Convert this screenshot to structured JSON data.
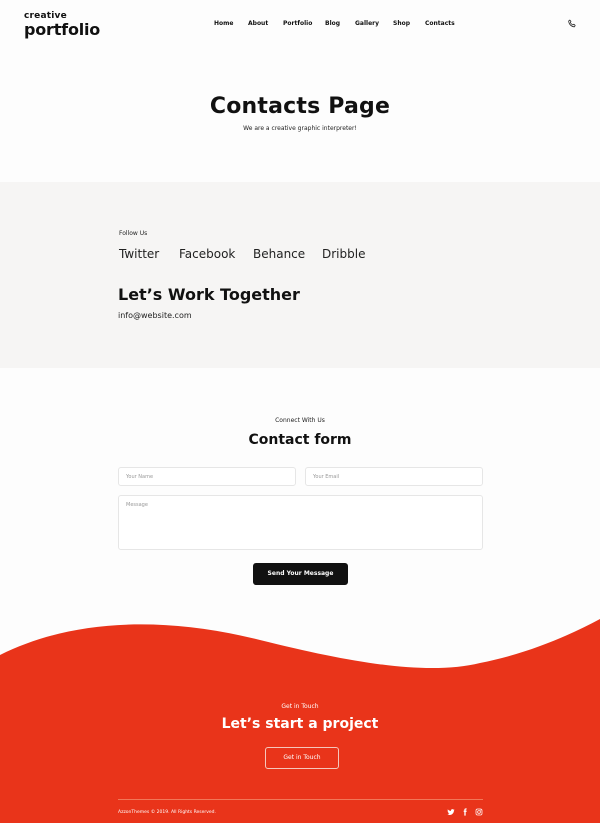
{
  "header": {
    "logo_line1": "creative",
    "logo_line2": "portfolio",
    "nav": [
      "Home",
      "About",
      "Portfolio",
      "Blog",
      "Gallery",
      "Shop",
      "Contacts"
    ],
    "phone_icon": "phone-icon"
  },
  "hero": {
    "title": "Contacts Page",
    "subtitle": "We are a creative graphic interpreter!"
  },
  "follow": {
    "label": "Follow Us",
    "links": [
      "Twitter",
      "Facebook",
      "Behance",
      "Dribble"
    ],
    "heading": "Let’s Work Together",
    "email": "info@website.com"
  },
  "contact_form": {
    "eyebrow": "Connect With Us",
    "title": "Contact form",
    "name_placeholder": "Your Name",
    "email_placeholder": "Your Email",
    "message_placeholder": "Message",
    "submit_label": "Send Your Message"
  },
  "footer": {
    "eyebrow": "Get in Touch",
    "title": "Let’s start a project",
    "button_label": "Get in Touch",
    "copyright": "AzzonThemes © 2019. All Rights Reserved.",
    "social_icons": [
      "twitter-icon",
      "facebook-icon",
      "instagram-icon"
    ]
  },
  "colors": {
    "accent": "#e9341a",
    "grey_band": "#f6f5f4",
    "button_dark": "#111111"
  }
}
